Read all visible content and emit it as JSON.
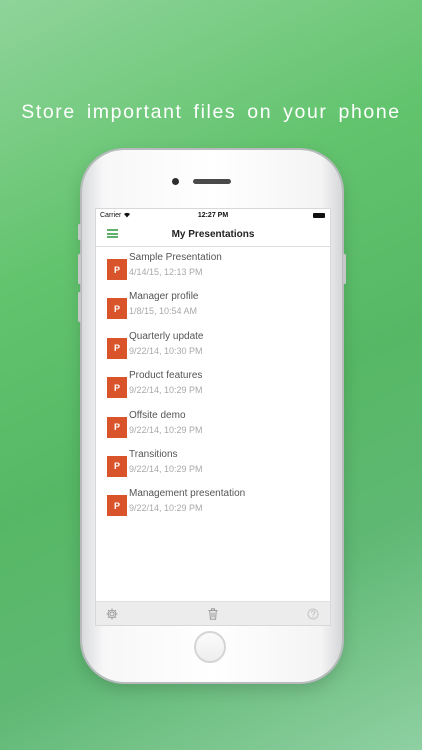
{
  "tagline": "Store important files on your phone",
  "status_bar": {
    "carrier": "Carrier",
    "time": "12:27 PM"
  },
  "navbar": {
    "title": "My Presentations"
  },
  "file_icon_letter": "P",
  "presentations": [
    {
      "name": "Sample Presentation",
      "date": "4/14/15, 12:13 PM"
    },
    {
      "name": "Manager profile",
      "date": "1/8/15, 10:54 AM"
    },
    {
      "name": "Quarterly update",
      "date": "9/22/14, 10:30 PM"
    },
    {
      "name": "Product features",
      "date": "9/22/14, 10:29 PM"
    },
    {
      "name": "Offsite demo",
      "date": "9/22/14, 10:29 PM"
    },
    {
      "name": "Transitions",
      "date": "9/22/14, 10:29 PM"
    },
    {
      "name": "Management presentation",
      "date": "9/22/14, 10:29 PM"
    }
  ],
  "toolbar": {
    "icons": [
      "gear-icon",
      "trash-icon",
      "help-icon"
    ]
  },
  "colors": {
    "accent_green": "#5fb06a",
    "file_icon_orange": "#d9542a",
    "background_green": "#56b865"
  }
}
